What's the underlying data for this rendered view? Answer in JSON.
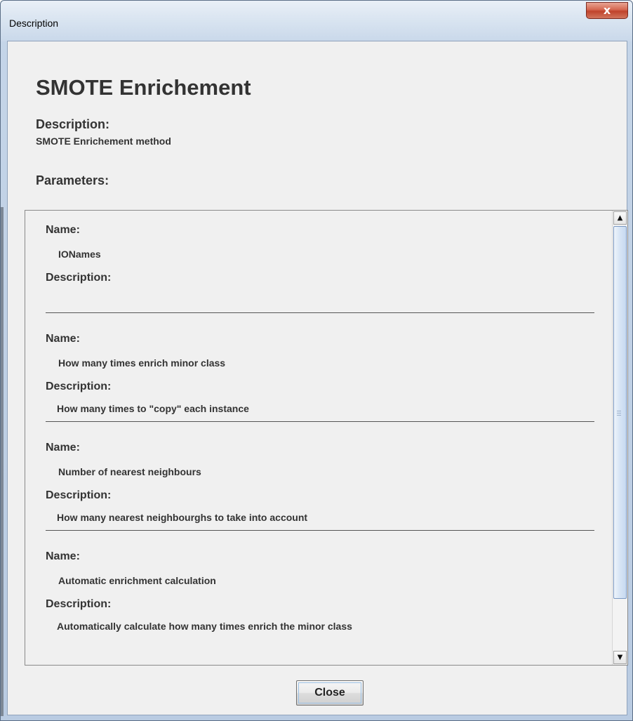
{
  "window": {
    "title": "Description",
    "close_glyph": "x"
  },
  "content": {
    "title": "SMOTE Enrichement",
    "description_heading": "Description:",
    "description_text": "SMOTE Enrichement method",
    "parameters_heading": "Parameters:"
  },
  "parameters": [
    {
      "name_label": "Name:",
      "name": "IONames",
      "description_label": "Description:",
      "description": ""
    },
    {
      "name_label": "Name:",
      "name": "How many times enrich minor class",
      "description_label": "Description:",
      "description": "How many times to \"copy\" each instance"
    },
    {
      "name_label": "Name:",
      "name": "Number of nearest neighbours",
      "description_label": "Description:",
      "description": "How many nearest neighbourghs to take into account"
    },
    {
      "name_label": "Name:",
      "name": "Automatic enrichment calculation",
      "description_label": "Description:",
      "description": "Automatically calculate how many times enrich the minor class"
    }
  ],
  "scrollbar": {
    "up_icon": "arrow-up-icon",
    "down_icon": "arrow-down-icon",
    "thumb_fraction": 0.88,
    "position_fraction": 0.0
  },
  "buttons": {
    "close_label": "Close"
  }
}
